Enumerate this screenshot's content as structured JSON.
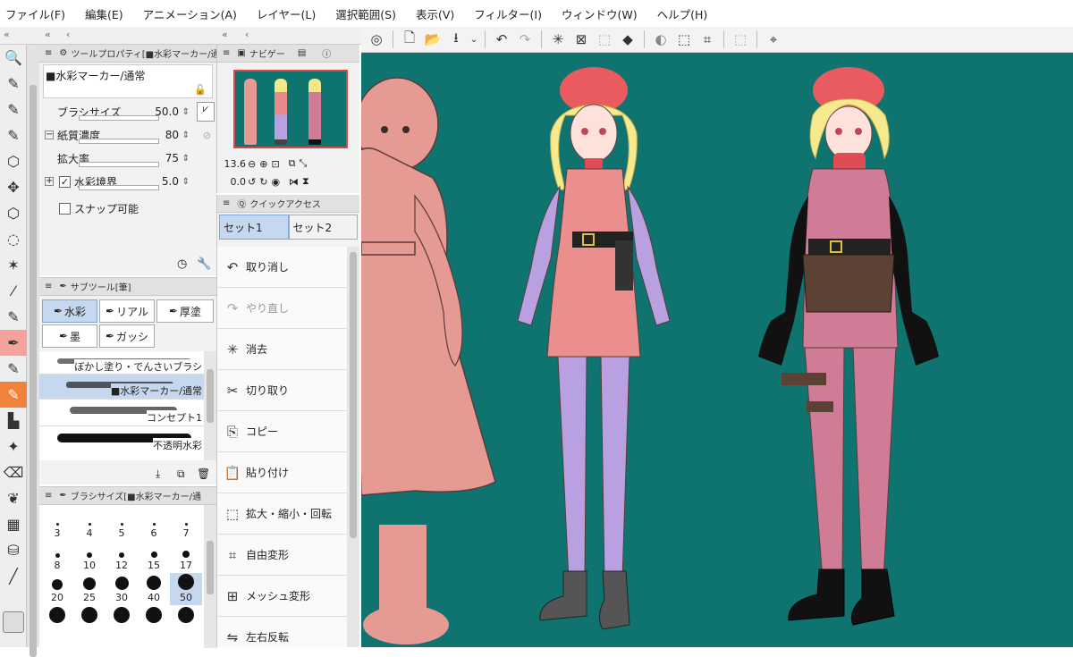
{
  "menu": [
    "ファイル(F)",
    "編集(E)",
    "アニメーション(A)",
    "レイヤー(L)",
    "選択範囲(S)",
    "表示(V)",
    "フィルター(I)",
    "ウィンドウ(W)",
    "ヘルプ(H)"
  ],
  "tool_property": {
    "header": "ツールプロパティ[■水彩マーカー/通",
    "preset": "■水彩マーカー/通常",
    "brush_size_label": "ブラシサイズ",
    "brush_size_value": "50.0",
    "paper_density_label": "紙質濃度",
    "paper_density_value": "80",
    "zoom_label": "拡大率",
    "zoom_value": "75",
    "watercolor_edge_label": "水彩境界",
    "watercolor_edge_value": "5.0",
    "snap_label": "スナップ可能"
  },
  "navigator": {
    "header": "ナビゲー",
    "zoom": "13.6",
    "rotation": "0.0"
  },
  "quick_access": {
    "header": "クイックアクセス",
    "tabs": [
      "セット1",
      "セット2"
    ],
    "items": [
      {
        "icon": "undo-icon",
        "label": "取り消し"
      },
      {
        "icon": "redo-icon",
        "label": "やり直し"
      },
      {
        "icon": "clear-icon",
        "label": "消去"
      },
      {
        "icon": "cut-icon",
        "label": "切り取り"
      },
      {
        "icon": "copy-icon",
        "label": "コピー"
      },
      {
        "icon": "paste-icon",
        "label": "貼り付け"
      },
      {
        "icon": "scale-rotate-icon",
        "label": "拡大・縮小・回転"
      },
      {
        "icon": "free-transform-icon",
        "label": "自由変形"
      },
      {
        "icon": "mesh-transform-icon",
        "label": "メッシュ変形"
      },
      {
        "icon": "flip-icon",
        "label": "左右反転"
      }
    ]
  },
  "subtool": {
    "header": "サブツール[筆]",
    "tabs": [
      "水彩",
      "リアル",
      "厚塗",
      "墨",
      "ガッシ"
    ],
    "brushes": [
      "ぼかし塗り・でんさいブラシ",
      "■水彩マーカー/通常",
      "コンセプト1",
      "不透明水彩"
    ]
  },
  "brush_size": {
    "header": "ブラシサイズ[■水彩マーカー/通",
    "rows": [
      [
        "3",
        "4",
        "5",
        "6",
        "7"
      ],
      [
        "8",
        "10",
        "12",
        "15",
        "17"
      ],
      [
        "20",
        "25",
        "30",
        "40",
        "50"
      ]
    ],
    "selected": "50"
  },
  "colors": {
    "canvas_bg": "#0f7470",
    "accent_tool": "#f0823b",
    "selection": "#c5d8ef"
  }
}
